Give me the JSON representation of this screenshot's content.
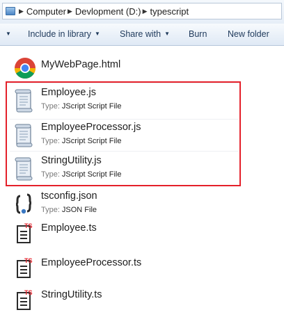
{
  "address_bar": {
    "breadcrumbs": [
      "Computer",
      "Devlopment (D:)",
      "typescript"
    ],
    "separator_icon": "chevron-right-icon"
  },
  "toolbar": {
    "items": [
      "Include in library",
      "Share with",
      "Burn",
      "New folder"
    ]
  },
  "files": [
    {
      "name": "MyWebPage.html",
      "icon": "chrome-html-icon",
      "type_label": "",
      "type": ""
    },
    {
      "name": "Employee.js",
      "icon": "script-scroll-icon",
      "type_label": "Type:",
      "type": "JScript Script File"
    },
    {
      "name": "EmployeeProcessor.js",
      "icon": "script-scroll-icon",
      "type_label": "Type:",
      "type": "JScript Script File"
    },
    {
      "name": "StringUtility.js",
      "icon": "script-scroll-icon",
      "type_label": "Type:",
      "type": "JScript Script File"
    },
    {
      "name": "tsconfig.json",
      "icon": "json-file-icon",
      "type_label": "Type:",
      "type": "JSON File"
    },
    {
      "name": "Employee.ts",
      "icon": "ts-file-icon",
      "type_label": "",
      "type": ""
    },
    {
      "name": "EmployeeProcessor.ts",
      "icon": "ts-file-icon",
      "type_label": "",
      "type": ""
    },
    {
      "name": "StringUtility.ts",
      "icon": "ts-file-icon",
      "type_label": "",
      "type": ""
    }
  ],
  "colors": {
    "highlight_border": "#e4202a",
    "toolbar_text": "#1e395b",
    "ts_badge": "#e4202a"
  }
}
